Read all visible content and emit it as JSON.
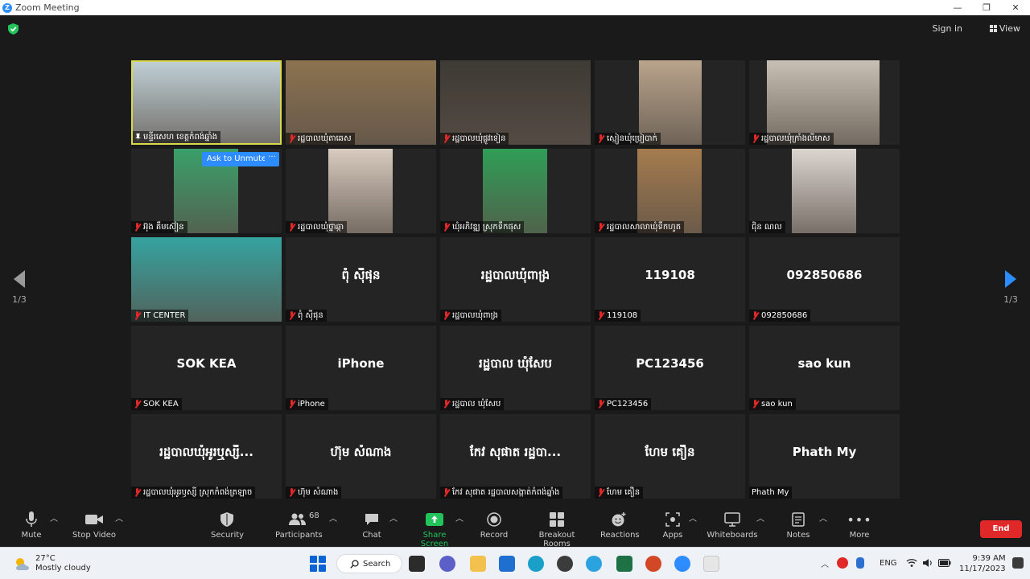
{
  "window": {
    "title": "Zoom Meeting",
    "minimize_icon": "minimize-icon",
    "maximize_icon": "restore-icon",
    "close_icon": "close-icon"
  },
  "top": {
    "sign_in": "Sign in",
    "view": "View"
  },
  "pager": {
    "left": "1/3",
    "right": "1/3"
  },
  "unmute_prompt": {
    "label": "Ask to Unmute",
    "more": "···"
  },
  "tiles": [
    {
      "caption": "មន្ទីរសេហ ខេត្តកំពង់ឆ្នាំង",
      "video": true,
      "active": true,
      "pinned": true,
      "muted": false,
      "video_color": "#bfcfd5"
    },
    {
      "caption": "រដ្ឋបាលឃុំតាឆេស",
      "video": true,
      "muted": true,
      "video_color": "#8c7350"
    },
    {
      "caption": "រដ្ឋបាលឃុំផ្លូវទៀន",
      "video": true,
      "muted": true,
      "video_color": "#3e3a34"
    },
    {
      "caption": "ស្មៀនឃុំប្រៀបាក់",
      "video": true,
      "muted": true,
      "video_color": "#b9a48c"
    },
    {
      "caption": "រដ្ឋបាលឃុំក្រាំងលីមាស",
      "video": true,
      "muted": true,
      "video_color": "#c8c0b4"
    },
    {
      "caption": "អ៊ុង គឹមស៊ៀន",
      "video": true,
      "muted": true,
      "video_color": "#3aa06a"
    },
    {
      "caption": "រដ្ឋបាលឃុំថ្នាឆ្កា",
      "video": true,
      "muted": true,
      "video_color": "#d8cbbf"
    },
    {
      "caption": "ឃុំអភិវឌ្ឍ ស្រុកទឹកផុស",
      "video": true,
      "muted": true,
      "video_color": "#2f9e56"
    },
    {
      "caption": "រដ្ឋបាលសាលាឃុំទឹកហូត",
      "video": true,
      "muted": true,
      "video_color": "#a57c4e"
    },
    {
      "caption": "ជ៉ិន ណល",
      "video": true,
      "muted": false,
      "video_color": "#dcd6d0"
    },
    {
      "caption": "IT CENTER",
      "video": true,
      "muted": true,
      "video_color": "#36a3a0"
    },
    {
      "name": "ពុំ ស៊ីផុន",
      "caption": "ពុំ ស៊ីផុន",
      "muted": true
    },
    {
      "name": "រដ្ឋបាលឃុំពាង្រ",
      "caption": "រដ្ឋបាលឃុំពាង្រ",
      "muted": true
    },
    {
      "name": "119108",
      "caption": "119108",
      "muted": true
    },
    {
      "name": "092850686",
      "caption": "092850686",
      "muted": true
    },
    {
      "name": "SOK KEA",
      "caption": "SOK KEA",
      "muted": true
    },
    {
      "name": "iPhone",
      "caption": "iPhone",
      "muted": true
    },
    {
      "name": "រដ្ឋបាល ឃុំសែប",
      "caption": "រដ្ឋបាល ឃុំសែប",
      "muted": true
    },
    {
      "name": "PC123456",
      "caption": "PC123456",
      "muted": true
    },
    {
      "name": "sao kun",
      "caption": "sao kun",
      "muted": true
    },
    {
      "name": "រដ្ឋបាលឃុំអូរឬស្សី...",
      "caption": "រដ្ឋបាលឃុំអូរឫស្សី ស្រុកកំពង់ត្រឡាច",
      "muted": true
    },
    {
      "name": "ហ៊ុម សំណាង",
      "caption": "ហ៊ុម សំណាង",
      "muted": true
    },
    {
      "name": "កែវ សុផាត រដ្ឋបា...",
      "caption": "កែវ សុផាត រដ្ឋបាលសង្កាត់កំពង់ឆ្នាំង",
      "muted": true
    },
    {
      "name": "ហែម គឿន",
      "caption": "ហែម គឿន",
      "muted": true
    },
    {
      "name": "Phath My",
      "caption": "Phath My",
      "muted": false
    }
  ],
  "toolbar": {
    "mute": "Mute",
    "stop_video": "Stop Video",
    "security": "Security",
    "participants": "Participants",
    "participants_count": "68",
    "chat": "Chat",
    "share_screen": "Share Screen",
    "record": "Record",
    "breakout_rooms": "Breakout Rooms",
    "reactions": "Reactions",
    "apps": "Apps",
    "whiteboards": "Whiteboards",
    "notes": "Notes",
    "more": "More",
    "end": "End",
    "share_color": "#22c35a",
    "end_color": "#e02828"
  },
  "taskbar": {
    "temperature": "27°C",
    "weather": "Mostly cloudy",
    "search": "Search",
    "language": "ENG",
    "time": "9:39 AM",
    "date": "11/17/2023"
  }
}
